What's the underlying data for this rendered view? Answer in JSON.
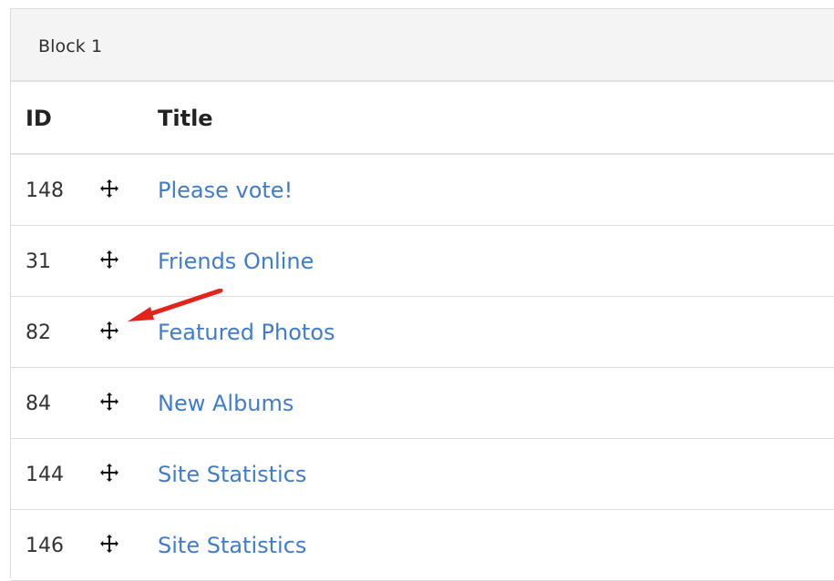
{
  "panel": {
    "block_title": "Block 1"
  },
  "table": {
    "headers": {
      "id": "ID",
      "title": "Title"
    },
    "rows": [
      {
        "id": "148",
        "title": "Please vote!",
        "icon": "move-icon"
      },
      {
        "id": "31",
        "title": "Friends Online",
        "icon": "move-icon"
      },
      {
        "id": "82",
        "title": "Featured Photos",
        "icon": "move-icon"
      },
      {
        "id": "84",
        "title": "New Albums",
        "icon": "move-icon"
      },
      {
        "id": "144",
        "title": "Site Statistics",
        "icon": "move-icon"
      },
      {
        "id": "146",
        "title": "Site Statistics",
        "icon": "move-icon"
      }
    ]
  },
  "colors": {
    "link": "#3f7cce",
    "annotation": "#e3241b",
    "header_bg": "#f4f4f4",
    "border": "#dddddd"
  }
}
